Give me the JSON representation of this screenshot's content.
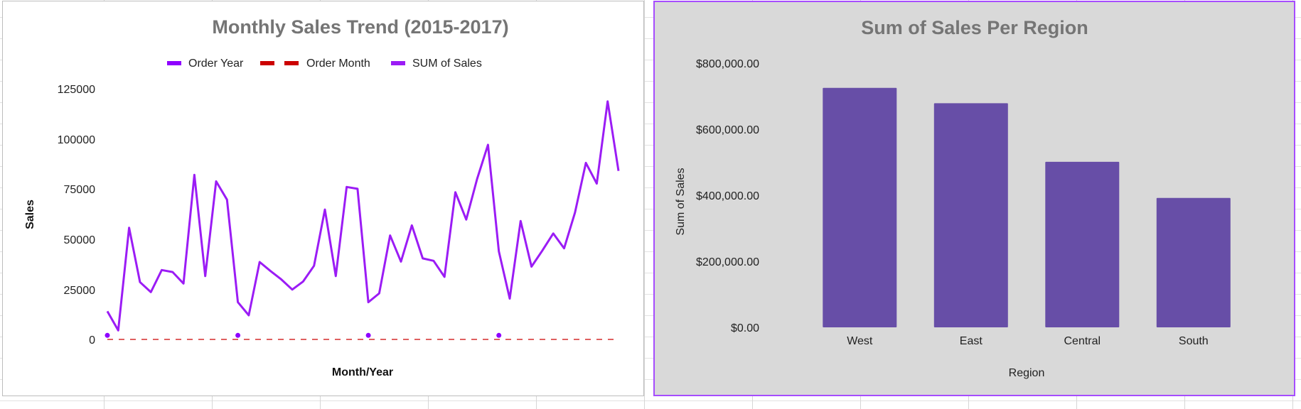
{
  "chart_data": [
    {
      "type": "line",
      "title": "Monthly Sales Trend (2015-2017)",
      "xlabel": "Month/Year",
      "ylabel": "Sales",
      "ylim": [
        0,
        125000
      ],
      "yticks": [
        "125000",
        "100000",
        "75000",
        "50000",
        "25000",
        "0"
      ],
      "legend_position": "top",
      "grid": false,
      "colors": {
        "order_year": "#8f00ff",
        "order_month": "#cc0000",
        "sum_of_sales": "#9b1cf5"
      },
      "series": [
        {
          "name": "Order Year",
          "display": "markers",
          "values": [
            2014,
            null,
            null,
            null,
            null,
            null,
            null,
            null,
            null,
            null,
            null,
            null,
            2015,
            null,
            null,
            null,
            null,
            null,
            null,
            null,
            null,
            null,
            null,
            null,
            2016,
            null,
            null,
            null,
            null,
            null,
            null,
            null,
            null,
            null,
            null,
            null,
            2017,
            null,
            null,
            null,
            null,
            null,
            null,
            null,
            null,
            null,
            null,
            null
          ]
        },
        {
          "name": "Order Month",
          "display": "dashed",
          "values": [
            1,
            2,
            3,
            4,
            5,
            6,
            7,
            8,
            9,
            10,
            11,
            12,
            1,
            2,
            3,
            4,
            5,
            6,
            7,
            8,
            9,
            10,
            11,
            12,
            1,
            2,
            3,
            4,
            5,
            6,
            7,
            8,
            9,
            10,
            11,
            12,
            1,
            2,
            3,
            4,
            5,
            6,
            7,
            8,
            9,
            10,
            11,
            12
          ]
        },
        {
          "name": "SUM of Sales",
          "display": "line",
          "values": [
            14000,
            4500,
            55500,
            28500,
            23500,
            34500,
            33500,
            27800,
            81800,
            31500,
            78600,
            69500,
            18500,
            12000,
            38500,
            34000,
            29800,
            24800,
            28800,
            36600,
            64600,
            31500,
            75800,
            74900,
            18500,
            22900,
            51700,
            38700,
            56700,
            40300,
            39100,
            31100,
            73200,
            59600,
            79800,
            96800,
            43800,
            20300,
            58900,
            36200,
            44200,
            52700,
            45300,
            63100,
            87800,
            77500,
            118400,
            83800
          ]
        }
      ]
    },
    {
      "type": "bar",
      "title": "Sum of Sales Per Region",
      "xlabel": "Region",
      "ylabel": "Sum of Sales",
      "categories": [
        "West",
        "East",
        "Central",
        "South"
      ],
      "values": [
        725458,
        678781,
        501240,
        391722
      ],
      "ylim": [
        0,
        800000
      ],
      "yticks": [
        "$800,000.00",
        "$600,000.00",
        "$400,000.00",
        "$200,000.00",
        "$0.00"
      ],
      "bar_color": "#674ea7",
      "grid": false
    }
  ]
}
